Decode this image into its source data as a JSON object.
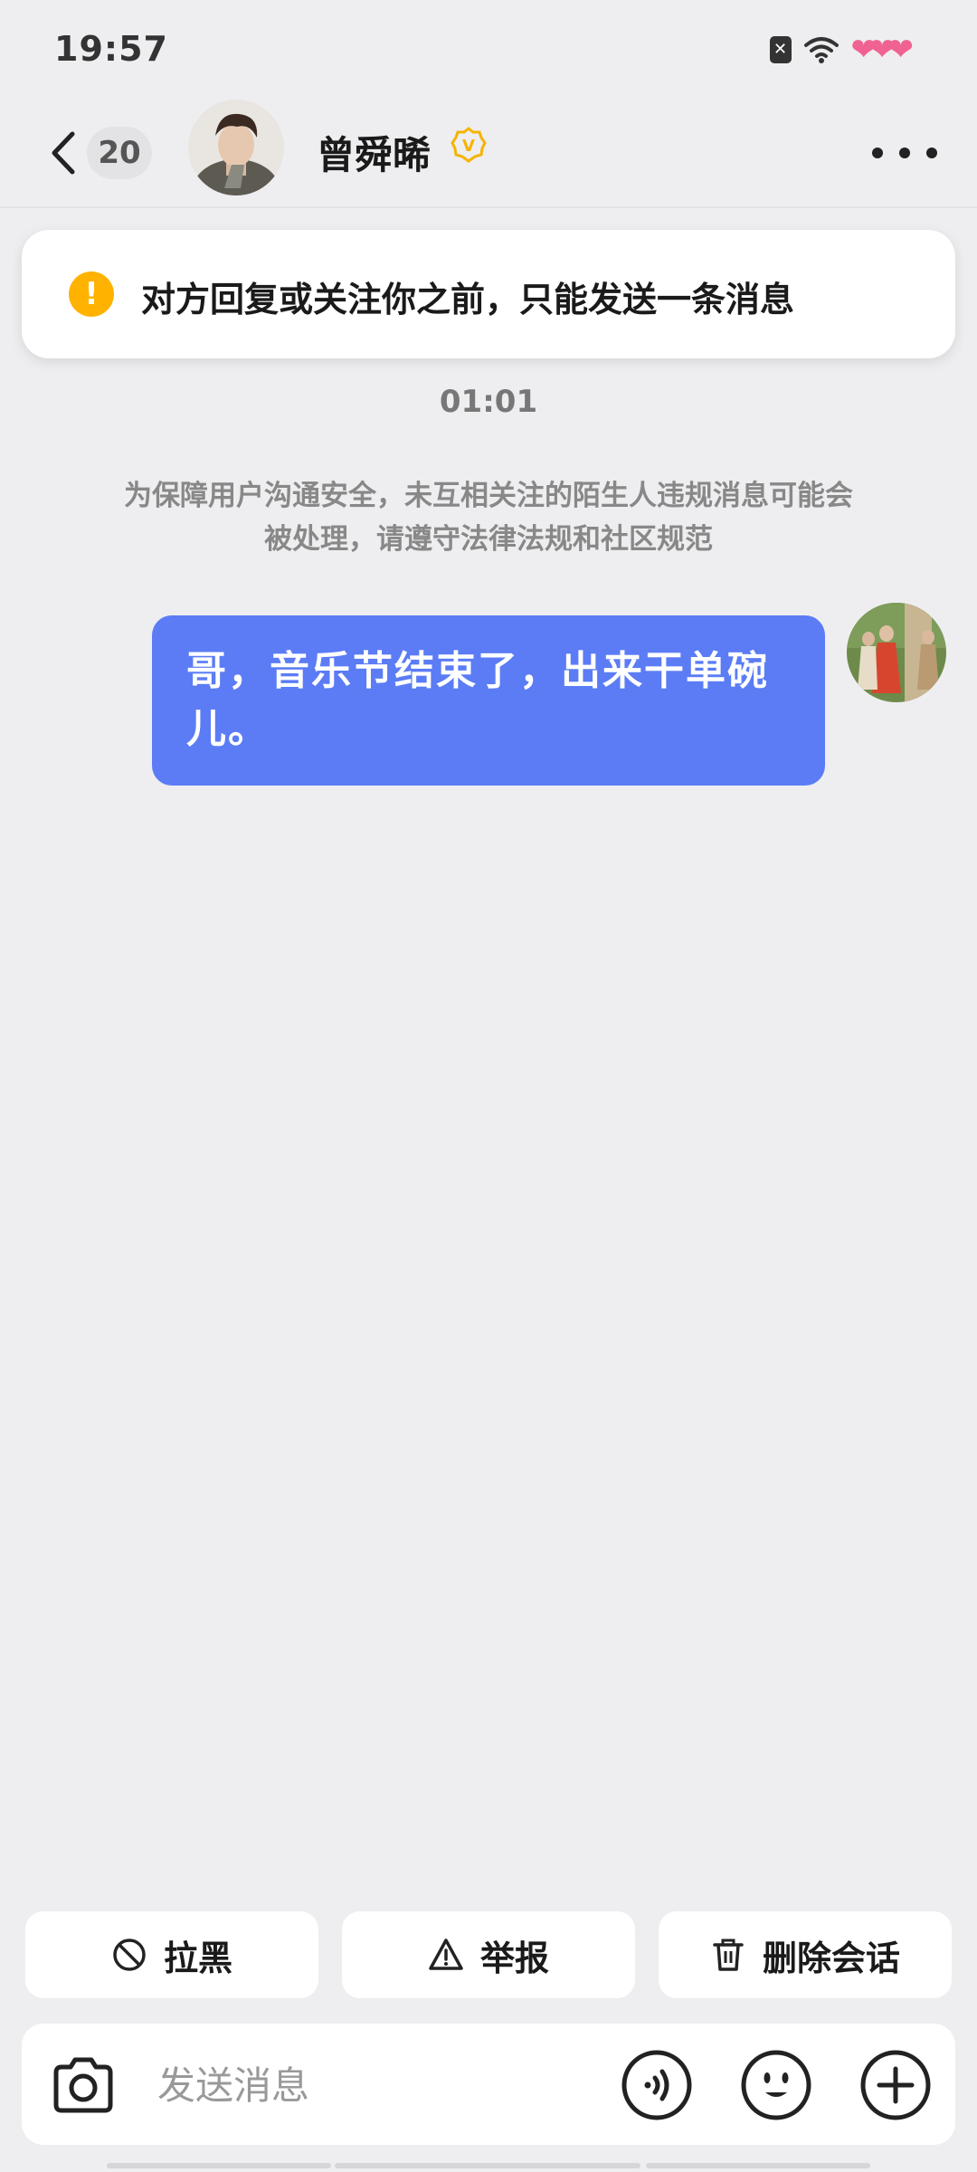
{
  "status_bar": {
    "time": "19:57",
    "icons": [
      "sim-off-icon",
      "wifi-icon",
      "hearts-icon"
    ]
  },
  "header": {
    "back_count": "20",
    "name": "曾舜晞",
    "verified_mark": "V"
  },
  "notice": {
    "icon": "!",
    "text": "对方回复或关注你之前，只能发送一条消息"
  },
  "timestamp": "01:01",
  "safety_text": "为保障用户沟通安全，未互相关注的陌生人违规消息可能会被处理，请遵守法律法规和社区规范",
  "messages": [
    {
      "from": "me",
      "text": "哥，音乐节结束了，出来干单碗儿。"
    }
  ],
  "actions": [
    {
      "label": "拉黑",
      "icon": "block-icon"
    },
    {
      "label": "举报",
      "icon": "warning-icon"
    },
    {
      "label": "删除会话",
      "icon": "trash-icon"
    }
  ],
  "composer": {
    "placeholder": "发送消息",
    "icons": [
      "camera-icon",
      "voice-icon",
      "emoji-icon",
      "plus-icon"
    ]
  },
  "colors": {
    "bubble": "#5b7cf5",
    "notice_icon": "#ffb300",
    "verified": "#f5b400",
    "background": "#eeeef0"
  }
}
